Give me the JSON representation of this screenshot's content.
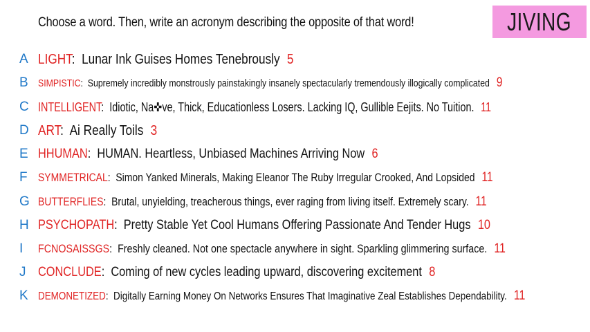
{
  "header": {
    "prompt": "Choose a word. Then, write an acronym describing the opposite of that word!",
    "badge": "JIVING"
  },
  "rows": [
    {
      "letter": "A",
      "word": "LIGHT",
      "acronym": "Lunar Ink Guises Homes Tenebrously",
      "count": "5"
    },
    {
      "letter": "B",
      "word": "SIMPISTIC",
      "acronym": "Supremely incredibly monstrously painstakingly insanely spectacularly tremendously illogically complicated",
      "count": "9"
    },
    {
      "letter": "C",
      "word": "INTELLIGENT",
      "acronym": "Idiotic, Na✜ve, Thick, Educationless Losers. Lacking IQ, Gullible Eejits. No Tuition.",
      "count": "11"
    },
    {
      "letter": "D",
      "word": "ART",
      "acronym": "Ai Really Toils",
      "count": "3"
    },
    {
      "letter": "E",
      "word": "HHUMAN",
      "acronym": "HUMAN. Heartless, Unbiased Machines Arriving Now",
      "count": "6"
    },
    {
      "letter": "F",
      "word": "SYMMETRICAL",
      "acronym": "Simon Yanked Minerals, Making Eleanor The Ruby Irregular Crooked, And Lopsided",
      "count": "11"
    },
    {
      "letter": "G",
      "word": "BUTTERFLIES",
      "acronym": "Brutal, unyielding, treacherous things, ever raging from living itself. Extremely scary.",
      "count": "11"
    },
    {
      "letter": "H",
      "word": "PSYCHOPATH",
      "acronym": "Pretty Stable Yet Cool Humans Offering Passionate And Tender Hugs",
      "count": "10"
    },
    {
      "letter": "I",
      "word": "FCNOSAISSGS",
      "acronym": "Freshly cleaned. Not one spectacle anywhere in sight. Sparkling glimmering surface.",
      "count": "11"
    },
    {
      "letter": "J",
      "word": "CONCLUDE",
      "acronym": "Coming of new cycles leading upward, discovering excitement",
      "count": "8"
    },
    {
      "letter": "K",
      "word": "DEMONETIZED",
      "acronym": "Digitally Earning Money On Networks Ensures That Imaginative Zeal Establishes Dependability.",
      "count": "11"
    }
  ],
  "colors": {
    "letter": "#1f78c8",
    "word": "#e02424",
    "badge_bg": "#f49ae0"
  }
}
